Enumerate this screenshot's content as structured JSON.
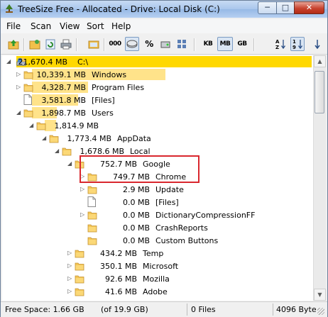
{
  "window": {
    "title": "TreeSize Free - Allocated - Drive: Local Disk (C:)"
  },
  "caption_buttons": {
    "minimize": "─",
    "maximize": "□",
    "close": "✕"
  },
  "menu": [
    "File",
    "Scan",
    "View",
    "Sort",
    "Help"
  ],
  "toolbar": {
    "units": [
      "KB",
      "MB",
      "GB"
    ],
    "active_unit": "MB",
    "percent": "%",
    "digits": "000"
  },
  "tree": {
    "root": {
      "size": "21,670.4 MB",
      "name": "C:\\",
      "share": 1.0
    },
    "rows": [
      {
        "size": "10,339.1 MB",
        "name": "Windows",
        "type": "folder",
        "share": 0.477
      },
      {
        "size": "4,328.7 MB",
        "name": "Program Files",
        "type": "folder",
        "share": 0.2
      },
      {
        "size": "3,581.8 MB",
        "name": "[Files]",
        "type": "file",
        "share": 0.165
      },
      {
        "size": "1,898.7 MB",
        "name": "Users",
        "type": "folder",
        "share": 0.088
      },
      {
        "size": "1,814.9 MB",
        "name": "",
        "type": "folder",
        "share": 0.956
      },
      {
        "size": "1,773.4 MB",
        "name": "AppData",
        "type": "folder",
        "share": 0.977
      },
      {
        "size": "1,678.6 MB",
        "name": "Local",
        "type": "folder",
        "share": 0.947
      },
      {
        "size": "752.7 MB",
        "name": "Google",
        "type": "folder",
        "share": 0.448
      },
      {
        "size": "749.7 MB",
        "name": "Chrome",
        "type": "folder",
        "share": 0.996
      },
      {
        "size": "2.9 MB",
        "name": "Update",
        "type": "folder",
        "share": 0.004
      },
      {
        "size": "0.0 MB",
        "name": "[Files]",
        "type": "file",
        "share": 0.0
      },
      {
        "size": "0.0 MB",
        "name": "DictionaryCompressionFF",
        "type": "folder",
        "share": 0.0
      },
      {
        "size": "0.0 MB",
        "name": "CrashReports",
        "type": "folder",
        "share": 0.0
      },
      {
        "size": "0.0 MB",
        "name": "Custom Buttons",
        "type": "folder",
        "share": 0.0
      },
      {
        "size": "434.2 MB",
        "name": "Temp",
        "type": "folder",
        "share": 0.259
      },
      {
        "size": "350.1 MB",
        "name": "Microsoft",
        "type": "folder",
        "share": 0.209
      },
      {
        "size": "92.6 MB",
        "name": "Mozilla",
        "type": "folder",
        "share": 0.055
      },
      {
        "size": "41.6 MB",
        "name": "Adobe",
        "type": "folder",
        "share": 0.025
      }
    ]
  },
  "status": {
    "free_space": "Free Space: 1.66 GB",
    "total": "(of 19.9 GB)",
    "files": "0  Files",
    "bytes": "4096 Byte"
  },
  "colors": {
    "bar": "#ffe38a",
    "root_bar": "#ffd800",
    "highlight": "#d9272e"
  }
}
